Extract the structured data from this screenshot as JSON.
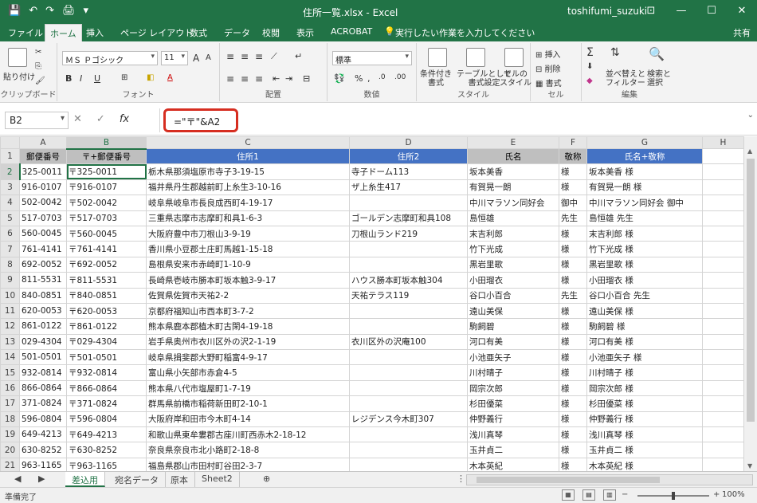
{
  "app": {
    "title": "住所一覧.xlsx - Excel",
    "user": "toshifumi_suzuki"
  },
  "qat": {
    "save": "💾",
    "undo": "↶",
    "redo": "↷",
    "print_preview": "🖨",
    "more": "▾"
  },
  "window_controls": {
    "ribbon_opts": "⊡",
    "minimize": "—",
    "maximize": "☐",
    "close": "✕"
  },
  "tabs": [
    "ファイル",
    "ホーム",
    "挿入",
    "ページ レイアウト",
    "数式",
    "データ",
    "校閲",
    "表示",
    "ACROBAT",
    "実行したい作業を入力してください"
  ],
  "tab_tell_icon": "💡",
  "share_label": "共有",
  "ribbon": {
    "clipboard": {
      "paste": "貼り付け",
      "label": "クリップボード"
    },
    "font": {
      "name": "ＭＳ Ｐゴシック",
      "size": "11",
      "bold": "B",
      "italic": "I",
      "underline": "U",
      "grow": "A",
      "shrink": "A",
      "label": "フォント"
    },
    "alignment": {
      "label": "配置"
    },
    "number": {
      "format": "標準",
      "label": "数値"
    },
    "styles": {
      "conditional": "条件付き\n書式",
      "table": "テーブルとして\n書式設定",
      "cell": "セルの\nスタイル",
      "label": "スタイル"
    },
    "cells": {
      "insert": "挿入",
      "delete": "削除",
      "format": "書式",
      "label": "セル"
    },
    "editing": {
      "sum": "Σ",
      "sort": "並べ替えと\nフィルター",
      "find": "検索と\n選択",
      "label": "編集"
    }
  },
  "formula_bar": {
    "name_box": "B2",
    "cancel": "✕",
    "enter": "✓",
    "fx": "fx",
    "formula": "=\"〒\"&A2",
    "expand": "⌄"
  },
  "columns": [
    "A",
    "B",
    "C",
    "D",
    "E",
    "F",
    "G",
    "H"
  ],
  "header_row": {
    "num": "1",
    "cells": [
      "郵便番号",
      "〒+郵便番号",
      "住所1",
      "住所2",
      "氏名",
      "敬称",
      "氏名+敬称",
      ""
    ]
  },
  "rows": [
    {
      "num": "2",
      "cells": [
        "325-0011",
        "〒325-0011",
        "栃木県那須塩原市寺子3-19-15",
        "寺子ドーム113",
        "坂本美香",
        "様",
        "坂本美香 様",
        ""
      ]
    },
    {
      "num": "3",
      "cells": [
        "916-0107",
        "〒916-0107",
        "福井県丹生郡越前町上糸生3-10-16",
        "ザ上糸生417",
        "有賀晃一朗",
        "様",
        "有賀晃一朗 様",
        ""
      ]
    },
    {
      "num": "4",
      "cells": [
        "502-0042",
        "〒502-0042",
        "岐阜県岐阜市長良成西町4-19-17",
        "",
        "中川マラソン同好会",
        "御中",
        "中川マラソン同好会 御中",
        ""
      ]
    },
    {
      "num": "5",
      "cells": [
        "517-0703",
        "〒517-0703",
        "三重県志摩市志摩町和具1-6-3",
        "ゴールデン志摩町和具108",
        "島恒雄",
        "先生",
        "島恒雄 先生",
        ""
      ]
    },
    {
      "num": "6",
      "cells": [
        "560-0045",
        "〒560-0045",
        "大阪府豊中市刀根山3-9-19",
        "刀根山ランド219",
        "末吉利郎",
        "様",
        "末吉利郎 様",
        ""
      ]
    },
    {
      "num": "7",
      "cells": [
        "761-4141",
        "〒761-4141",
        "香川県小豆郡土庄町馬越1-15-18",
        "",
        "竹下光成",
        "様",
        "竹下光成 様",
        ""
      ]
    },
    {
      "num": "8",
      "cells": [
        "692-0052",
        "〒692-0052",
        "島根県安来市赤崎町1-10-9",
        "",
        "黒岩里歌",
        "様",
        "黒岩里歌 様",
        ""
      ]
    },
    {
      "num": "9",
      "cells": [
        "811-5531",
        "〒811-5531",
        "長崎県壱岐市勝本町坂本触3-9-17",
        "ハウス勝本町坂本触304",
        "小田瑠衣",
        "様",
        "小田瑠衣 様",
        ""
      ]
    },
    {
      "num": "10",
      "cells": [
        "840-0851",
        "〒840-0851",
        "佐賀県佐賀市天祐2-2",
        "天祐テラス119",
        "谷口小百合",
        "先生",
        "谷口小百合 先生",
        ""
      ]
    },
    {
      "num": "11",
      "cells": [
        "620-0053",
        "〒620-0053",
        "京都府福知山市西本町3-7-2",
        "",
        "遠山美保",
        "様",
        "遠山美保 様",
        ""
      ]
    },
    {
      "num": "12",
      "cells": [
        "861-0122",
        "〒861-0122",
        "熊本県鹿本郡植木町古閑4-19-18",
        "",
        "駒飼碧",
        "様",
        "駒飼碧 様",
        ""
      ]
    },
    {
      "num": "13",
      "cells": [
        "029-4304",
        "〒029-4304",
        "岩手県奥州市衣川区外の沢2-1-19",
        "衣川区外の沢庵100",
        "河口有美",
        "様",
        "河口有美 様",
        ""
      ]
    },
    {
      "num": "14",
      "cells": [
        "501-0501",
        "〒501-0501",
        "岐阜県揖斐郡大野町稲富4-9-17",
        "",
        "小池亜矢子",
        "様",
        "小池亜矢子 様",
        ""
      ]
    },
    {
      "num": "15",
      "cells": [
        "932-0814",
        "〒932-0814",
        "富山県小矢部市赤倉4-5",
        "",
        "川村晴子",
        "様",
        "川村晴子 様",
        ""
      ]
    },
    {
      "num": "16",
      "cells": [
        "866-0864",
        "〒866-0864",
        "熊本県八代市塩屋町1-7-19",
        "",
        "岡宗次郎",
        "様",
        "岡宗次郎 様",
        ""
      ]
    },
    {
      "num": "17",
      "cells": [
        "371-0824",
        "〒371-0824",
        "群馬県前橋市稲荷新田町2-10-1",
        "",
        "杉田優菜",
        "様",
        "杉田優菜 様",
        ""
      ]
    },
    {
      "num": "18",
      "cells": [
        "596-0804",
        "〒596-0804",
        "大阪府岸和田市今木町4-14",
        "レジデンス今木町307",
        "仲野義行",
        "様",
        "仲野義行 様",
        ""
      ]
    },
    {
      "num": "19",
      "cells": [
        "649-4213",
        "〒649-4213",
        "和歌山県東牟婁郡古座川町西赤木2-18-12",
        "",
        "浅川真琴",
        "様",
        "浅川真琴 様",
        ""
      ]
    },
    {
      "num": "20",
      "cells": [
        "630-8252",
        "〒630-8252",
        "奈良県奈良市北小路町2-18-8",
        "",
        "玉井貞二",
        "様",
        "玉井貞二 様",
        ""
      ]
    },
    {
      "num": "21",
      "cells": [
        "963-1165",
        "〒963-1165",
        "福島県郡山市田村町谷田2-3-7",
        "",
        "木本英紀",
        "様",
        "木本英紀 様",
        ""
      ]
    }
  ],
  "sheet_tabs": [
    "差込用",
    "宛名データ",
    "原本",
    "Sheet2"
  ],
  "sheet_nav": {
    "prev": "◀",
    "next": "▶",
    "add": "⊕",
    "more": "⋮"
  },
  "status": {
    "text": "準備完了",
    "zoom": "100%",
    "zoom_minus": "−",
    "zoom_plus": "+"
  },
  "colors": {
    "excel_green": "#217346",
    "header_blue": "#4472c4",
    "header_gray": "#bfbfbf",
    "highlight_red": "#d62d20"
  }
}
